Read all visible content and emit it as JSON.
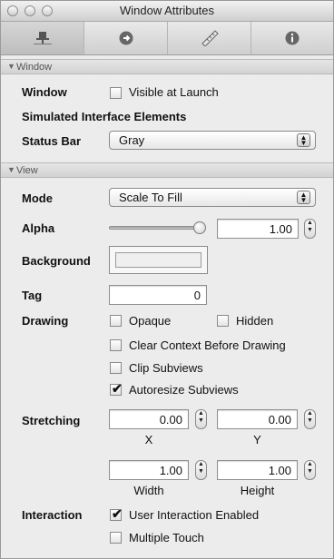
{
  "window": {
    "title": "Window Attributes",
    "tabs": [
      {
        "icon": "attributes-icon"
      },
      {
        "icon": "connections-icon"
      },
      {
        "icon": "size-ruler-icon"
      },
      {
        "icon": "info-icon"
      }
    ]
  },
  "window_section": {
    "header": "Window",
    "window_label": "Window",
    "visible_at_launch": {
      "label": "Visible at Launch",
      "checked": false
    },
    "simulated_label": "Simulated Interface Elements",
    "status_bar": {
      "label": "Status Bar",
      "value": "Gray"
    }
  },
  "view_section": {
    "header": "View",
    "mode": {
      "label": "Mode",
      "value": "Scale To Fill"
    },
    "alpha": {
      "label": "Alpha",
      "value": "1.00",
      "slider_fraction": 1.0
    },
    "background": {
      "label": "Background"
    },
    "tag": {
      "label": "Tag",
      "value": "0"
    },
    "drawing": {
      "label": "Drawing",
      "opaque": {
        "label": "Opaque",
        "checked": false
      },
      "hidden": {
        "label": "Hidden",
        "checked": false
      },
      "clear_context": {
        "label": "Clear Context Before Drawing",
        "checked": false
      },
      "clip_subviews": {
        "label": "Clip Subviews",
        "checked": false
      },
      "autoresize": {
        "label": "Autoresize Subviews",
        "checked": true
      }
    },
    "stretching": {
      "label": "Stretching",
      "x": "0.00",
      "x_label": "X",
      "y": "0.00",
      "y_label": "Y",
      "width": "1.00",
      "width_label": "Width",
      "height": "1.00",
      "height_label": "Height"
    },
    "interaction": {
      "label": "Interaction",
      "user_interaction": {
        "label": "User Interaction Enabled",
        "checked": true
      },
      "multiple_touch": {
        "label": "Multiple Touch",
        "checked": false
      }
    }
  }
}
